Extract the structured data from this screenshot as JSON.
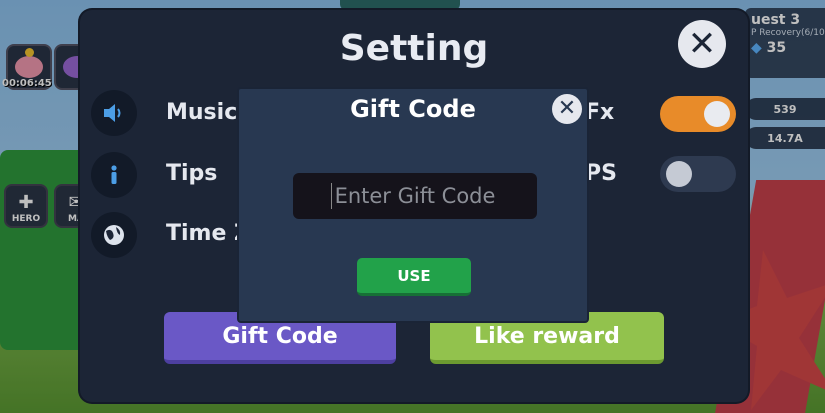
{
  "hud": {
    "timer": "00:06:45",
    "quest_title": "uest 3",
    "quest_subtitle": "P Recovery(6/10",
    "quest_gems": "35",
    "resource_1": "539",
    "resource_2": "14.7A",
    "hero_label": "HERO",
    "mail_label": "MA"
  },
  "setting": {
    "title": "Setting",
    "close_icon": "close-x",
    "rows": [
      {
        "label": "Music",
        "icon": "speaker-icon"
      },
      {
        "label": "Tips",
        "icon": "info-icon"
      },
      {
        "label": "Time Z",
        "icon": "globe-icon"
      }
    ],
    "right_rows": [
      {
        "label": "Fx",
        "toggle": "on"
      },
      {
        "label": "PS",
        "toggle": "off"
      }
    ],
    "gift_code_button": "Gift Code",
    "like_reward_button": "Like reward"
  },
  "gift_dialog": {
    "title": "Gift Code",
    "input_placeholder": "Enter Gift Code",
    "input_value": "",
    "use_button": "USE"
  },
  "colors": {
    "panel_bg": "#1c2536",
    "dialog_bg": "#283851",
    "toggle_on": "#e88b29",
    "gift_code_btn": "#6a58c6",
    "like_reward_btn": "#92c24d",
    "use_btn": "#22a24a"
  }
}
